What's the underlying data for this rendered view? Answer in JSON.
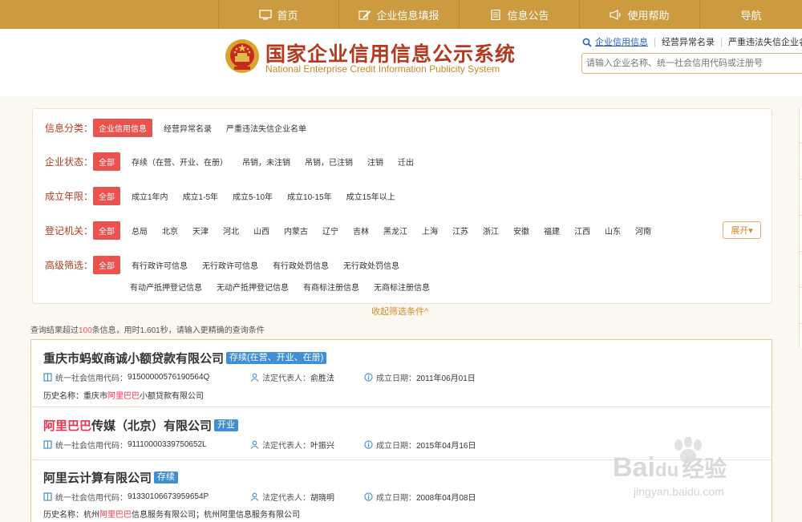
{
  "nav": {
    "items": [
      {
        "label": "首页",
        "icon": "monitor-icon"
      },
      {
        "label": "企业信息填报",
        "icon": "edit-icon"
      },
      {
        "label": "信息公告",
        "icon": "document-icon"
      },
      {
        "label": "使用帮助",
        "icon": "megaphone-icon"
      },
      {
        "label": "导航",
        "icon": ""
      }
    ]
  },
  "header": {
    "title_cn": "国家企业信用信息公示系统",
    "title_en": "National Enterprise Credit Information Publicity System",
    "search_tabs": [
      "企业信用信息",
      "经营异常名录",
      "严重违法失信企业名"
    ],
    "search_placeholder": "请输入企业名称、统一社会信用代码或注册号"
  },
  "filters": {
    "category": {
      "label": "信息分类：",
      "options": [
        "企业信用信息",
        "经营异常名录",
        "严重违法失信企业名单"
      ],
      "selected": 0
    },
    "status": {
      "label": "企业状态：",
      "options": [
        "全部",
        "存续（在营、开业、在册）",
        "吊销，未注销",
        "吊销，已注销",
        "注销",
        "迁出"
      ],
      "selected": 0
    },
    "age": {
      "label": "成立年限：",
      "options": [
        "全部",
        "成立1年内",
        "成立1-5年",
        "成立5-10年",
        "成立10-15年",
        "成立15年以上"
      ],
      "selected": 0
    },
    "authority": {
      "label": "登记机关：",
      "options": [
        "全部",
        "总局",
        "北京",
        "天津",
        "河北",
        "山西",
        "内蒙古",
        "辽宁",
        "吉林",
        "黑龙江",
        "上海",
        "江苏",
        "浙江",
        "安徽",
        "福建",
        "江西",
        "山东",
        "河南"
      ],
      "selected": 0
    },
    "advanced": {
      "label": "高级筛选：",
      "options_row1": [
        "全部",
        "有行政许可信息",
        "无行政许可信息",
        "有行政处罚信息",
        "无行政处罚信息"
      ],
      "options_row2": [
        "有动产抵押登记信息",
        "无动产抵押登记信息",
        "有商标注册信息",
        "无商标注册信息"
      ],
      "selected": 0
    },
    "expand_label": "展开▾",
    "collapse_label": "收起筛选条件^"
  },
  "result_info": {
    "prefix": "查询结果超过",
    "count": "100",
    "suffix": "条信息，用时1.601秒，请输入更精确的查询条件"
  },
  "results": [
    {
      "name_pre": "重庆市蚂蚁商诚小额贷款有限公司",
      "name_hl": "",
      "name_post": "",
      "status": "存续(在营、开业、在册)",
      "code_label": "统一社会信用代码：",
      "code": "91500000576190564Q",
      "rep_label": "法定代表人：",
      "rep": "俞胜法",
      "date_label": "成立日期：",
      "date": "2011年06月01日",
      "hist_label": "历史名称：",
      "hist_pre": "重庆市",
      "hist_hl": "阿里巴巴",
      "hist_post": "小额贷款有限公司"
    },
    {
      "name_pre": "",
      "name_hl": "阿里巴巴",
      "name_post": "传媒（北京）有限公司",
      "status": "开业",
      "code_label": "统一社会信用代码：",
      "code": "91110000339750652L",
      "rep_label": "法定代表人：",
      "rep": "叶振兴",
      "date_label": "成立日期：",
      "date": "2015年04月16日",
      "hist_label": "",
      "hist_pre": "",
      "hist_hl": "",
      "hist_post": ""
    },
    {
      "name_pre": "阿里云计算有限公司",
      "name_hl": "",
      "name_post": "",
      "status": "存续",
      "code_label": "统一社会信用代码：",
      "code": "91330106673959654P",
      "rep_label": "法定代表人：",
      "rep": "胡晓明",
      "date_label": "成立日期：",
      "date": "2008年04月08日",
      "hist_label": "历史名称：",
      "hist_pre": "杭州",
      "hist_hl": "阿里巴巴",
      "hist_post": "信息服务有限公司；杭州阿里信息服务有限公司"
    }
  ],
  "watermark": {
    "brand": "Bai",
    "brand2": "du",
    "brand_cn": "经验",
    "url": "jingyan.baidu.com"
  }
}
